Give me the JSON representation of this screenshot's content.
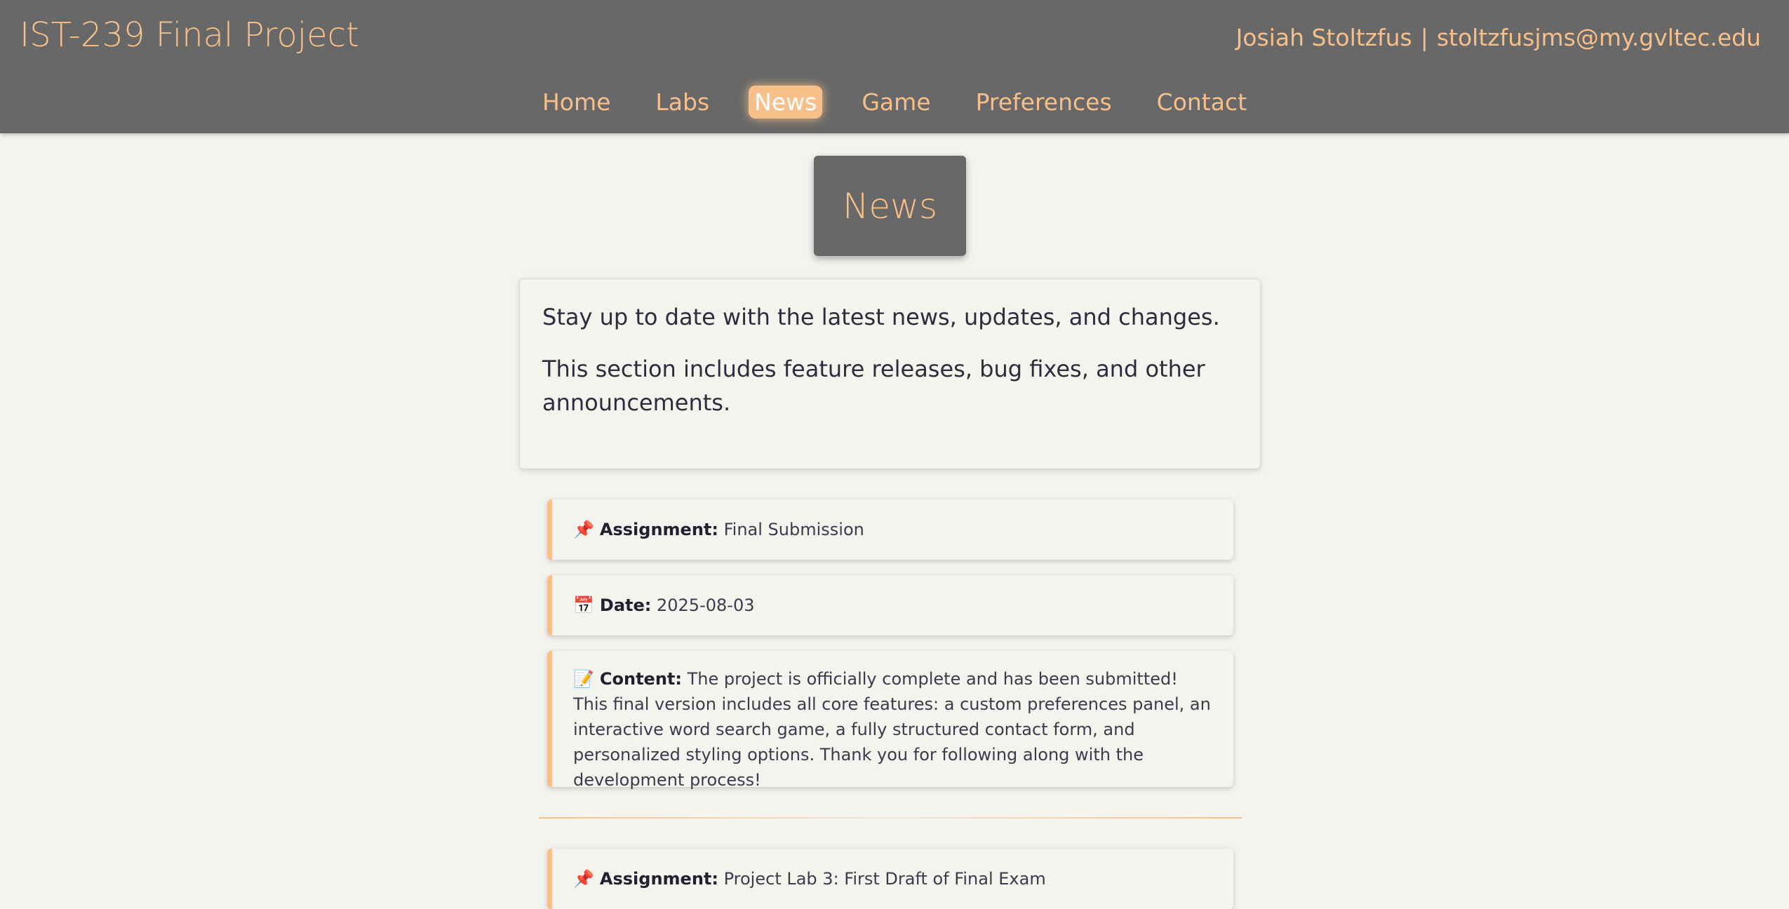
{
  "header": {
    "site_title": "IST-239 Final Project",
    "user_name": "Josiah Stoltzfus",
    "separator": "|",
    "user_email": "stoltzfusjms@my.gvltec.edu"
  },
  "nav": {
    "items": [
      {
        "label": "Home"
      },
      {
        "label": "Labs"
      },
      {
        "label": "News"
      },
      {
        "label": "Game"
      },
      {
        "label": "Preferences"
      },
      {
        "label": "Contact"
      }
    ],
    "active": "News"
  },
  "page": {
    "title": "News",
    "intro": [
      "Stay up to date with the latest news, updates, and changes.",
      "This section includes feature releases, bug fixes, and other announcements."
    ]
  },
  "news": [
    {
      "assignment_label": "Assignment:",
      "assignment": "Final Submission",
      "date_label": "Date:",
      "date": "2025-08-03",
      "content_label": "Content:",
      "content": "The project is officially complete and has been submitted! This final version includes all core features: a custom preferences panel, an interactive word search game, a fully structured contact form, and personalized styling options. Thank you for following along with the development process!"
    },
    {
      "assignment_label": "Assignment:",
      "assignment": "Project Lab 3: First Draft of Final Exam"
    }
  ],
  "icons": {
    "assignment": "pushpin-icon",
    "date": "calendar-icon",
    "content": "memo-icon"
  },
  "colors": {
    "header_bg": "#686868",
    "accent": "#f7c08a",
    "page_bg": "#f5f3ee"
  }
}
